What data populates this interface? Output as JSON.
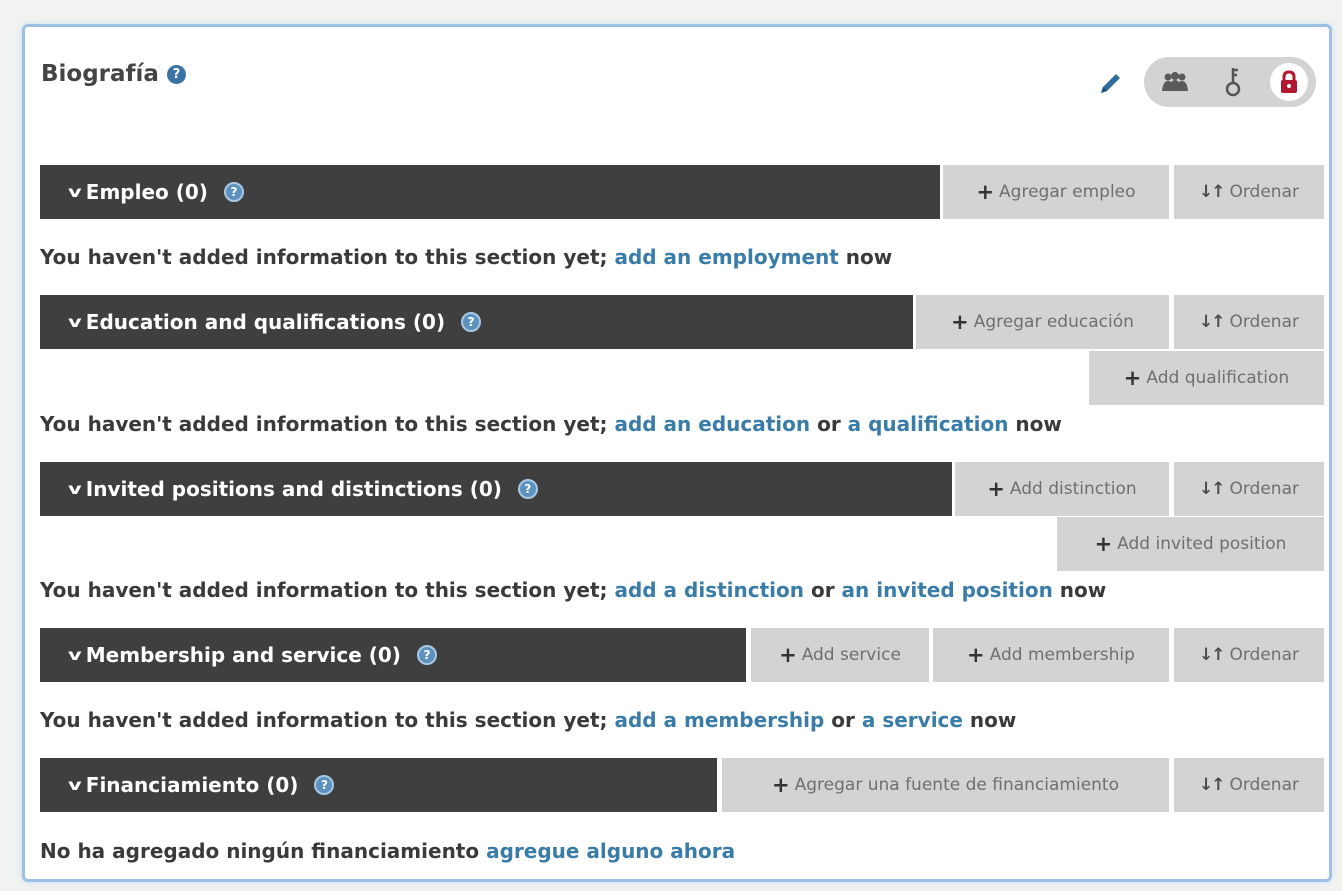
{
  "header": {
    "title": "Biografía",
    "help": "?"
  },
  "colors": {
    "section_bar": "#3f3f40",
    "button_bg": "#d3d3d3",
    "link": "#3a7ca8",
    "help_icon": "#3a74a5",
    "lock": "#b3182e",
    "panel_border": "#9ebfe6"
  },
  "icons": {
    "edit": "pencil-icon",
    "privacy": [
      "everyone-icon",
      "trusted-parties-icon",
      "lock-icon"
    ],
    "add": "plus-icon",
    "sort": "sort-icon",
    "expand": "chevron-down-icon",
    "help": "question-icon"
  },
  "sections": [
    {
      "title": "Empleo (0)",
      "buttons": [
        "Agregar empleo"
      ],
      "sort": "Ordenar",
      "message": {
        "prefix": "You haven't added information to this section yet; ",
        "link1": "add an employment",
        "suffix": " now"
      }
    },
    {
      "title": "Education and qualifications (0)",
      "buttons": [
        "Agregar educación",
        "Add qualification"
      ],
      "sort": "Ordenar",
      "message": {
        "prefix": "You haven't added information to this section yet; ",
        "link1": "add an education",
        "mid": " or ",
        "link2": "a qualification",
        "suffix": " now"
      }
    },
    {
      "title": "Invited positions and distinctions (0)",
      "buttons": [
        "Add distinction",
        "Add invited position"
      ],
      "sort": "Ordenar",
      "message": {
        "prefix": "You haven't added information to this section yet; ",
        "link1": "add a distinction",
        "mid": " or ",
        "link2": "an invited position",
        "suffix": " now"
      }
    },
    {
      "title": "Membership and service (0)",
      "buttons": [
        "Add service",
        "Add membership"
      ],
      "sort": "Ordenar",
      "message": {
        "prefix": "You haven't added information to this section yet; ",
        "link1": "add a membership",
        "mid": " or ",
        "link2": "a service",
        "suffix": " now"
      }
    },
    {
      "title": "Financiamiento (0)",
      "buttons": [
        "Agregar una fuente de financiamiento"
      ],
      "sort": "Ordenar",
      "message": {
        "prefix": "No ha agregado ningún financiamiento ",
        "link1": "agregue alguno ahora"
      }
    }
  ]
}
